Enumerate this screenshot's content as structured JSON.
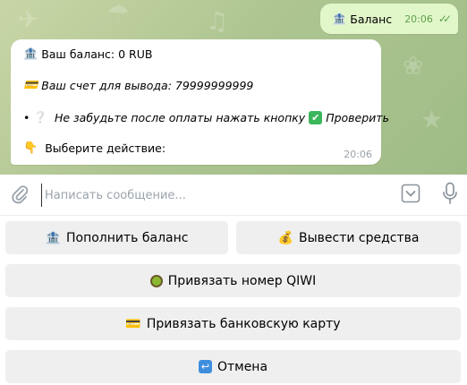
{
  "chat": {
    "outgoing": {
      "icon": "bank-icon",
      "text": "Баланс",
      "time": "20:06",
      "status": "read"
    },
    "incoming": {
      "balance_icon": "bank-icon",
      "balance_text": "Ваш баланс: 0 RUB",
      "account_icon": "credit-card-icon",
      "account_text": "Ваш счет для вывода: 79999999999",
      "reminder_text": "Не забудьте после оплаты нажать кнопку",
      "reminder_button_text": "Проверить",
      "action_icon": "pointing-down-icon",
      "action_text": "Выберите действие:",
      "time": "20:06"
    }
  },
  "composer": {
    "placeholder": "Написать сообщение..."
  },
  "keyboard": {
    "topup_label": "Пополнить баланс",
    "withdraw_label": "Вывести средства",
    "qiwi_label": "Привязать номер QIWI",
    "card_label": "Привязать банковскую карту",
    "cancel_label": "Отмена"
  },
  "colors": {
    "chat_bg": "#aec591",
    "outgoing_bubble": "#e1f7c9",
    "incoming_bubble": "#ffffff",
    "read_check": "#5fa14b",
    "keyboard_button": "#efefef"
  }
}
